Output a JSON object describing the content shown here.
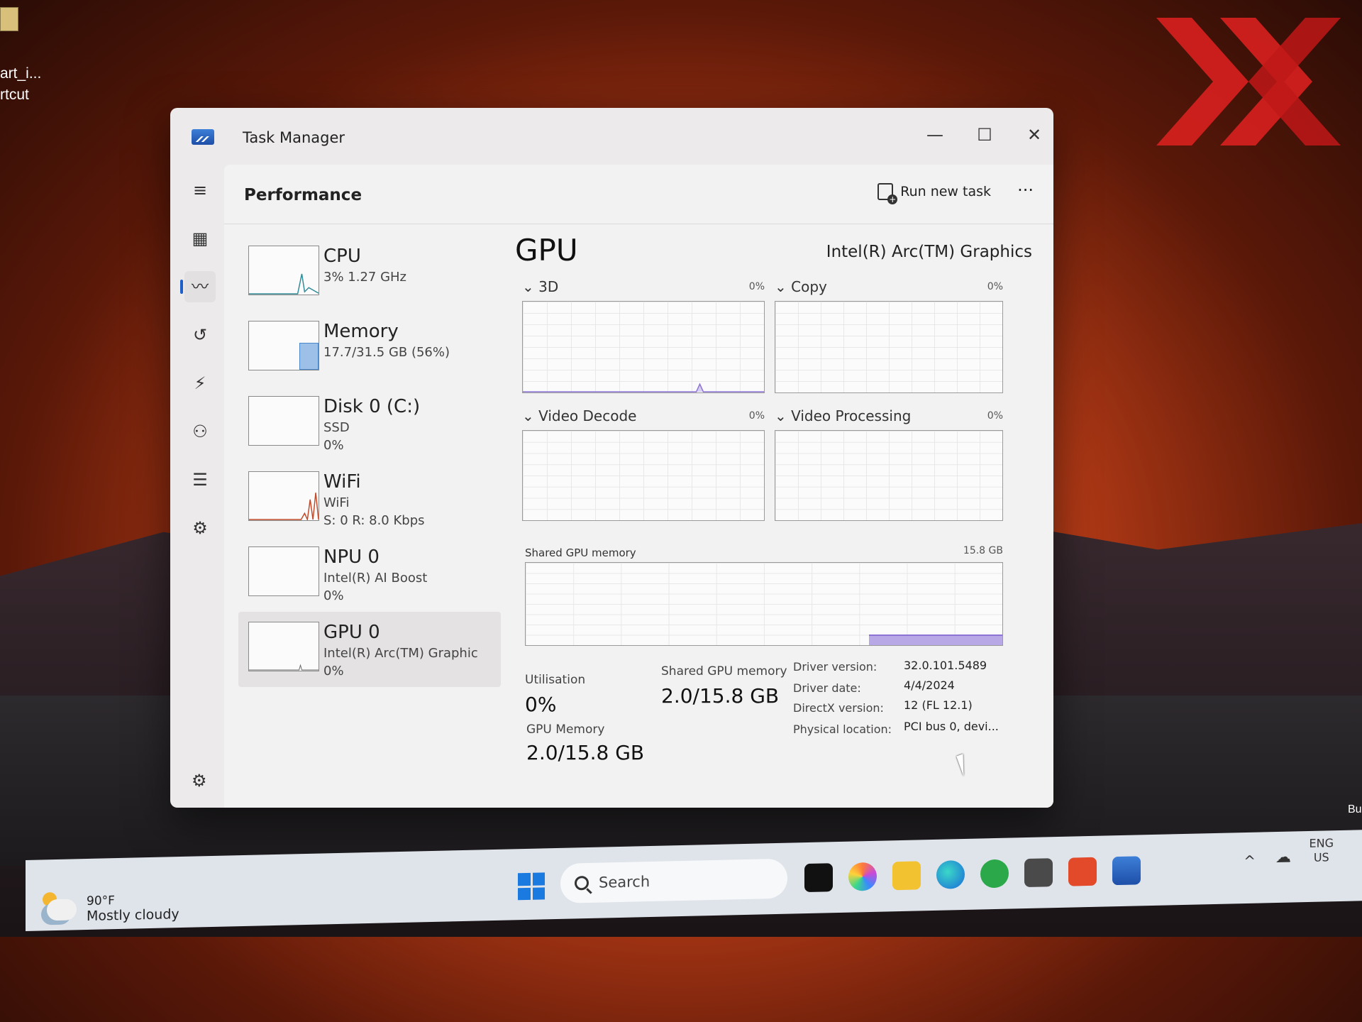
{
  "desktop": {
    "shortcut_label_1": "art_i...",
    "shortcut_label_2": "rtcut",
    "corner_text": "Bu"
  },
  "window": {
    "title": "Task Manager",
    "minimize": "—",
    "maximize": "☐",
    "close": "✕"
  },
  "nav": {
    "items": [
      {
        "icon": "hamburger-icon",
        "glyph": "≡"
      },
      {
        "icon": "processes-icon",
        "glyph": "▦"
      },
      {
        "icon": "performance-icon",
        "glyph": "〰"
      },
      {
        "icon": "app-history-icon",
        "glyph": "↺"
      },
      {
        "icon": "startup-apps-icon",
        "glyph": "⚡"
      },
      {
        "icon": "users-icon",
        "glyph": "⚇"
      },
      {
        "icon": "details-icon",
        "glyph": "☰"
      },
      {
        "icon": "services-icon",
        "glyph": "⚙"
      }
    ],
    "settings_glyph": "⚙"
  },
  "header": {
    "title": "Performance",
    "run_new_task": "Run new task",
    "more": "···"
  },
  "devices": [
    {
      "name": "CPU",
      "line1": "3%  1.27 GHz",
      "line2": ""
    },
    {
      "name": "Memory",
      "line1": "17.7/31.5 GB (56%)",
      "line2": ""
    },
    {
      "name": "Disk 0 (C:)",
      "line1": "SSD",
      "line2": "0%"
    },
    {
      "name": "WiFi",
      "line1": "WiFi",
      "line2": "S: 0  R: 8.0 Kbps"
    },
    {
      "name": "NPU 0",
      "line1": "Intel(R) AI Boost",
      "line2": "0%"
    },
    {
      "name": "GPU 0",
      "line1": "Intel(R) Arc(TM) Graphic",
      "line2": "0%"
    }
  ],
  "gpu": {
    "title": "GPU",
    "model": "Intel(R) Arc(TM) Graphics",
    "graphs": [
      {
        "label": "3D",
        "percent": "0%"
      },
      {
        "label": "Copy",
        "percent": "0%"
      },
      {
        "label": "Video Decode",
        "percent": "0%"
      },
      {
        "label": "Video Processing",
        "percent": "0%"
      }
    ],
    "chevron": "⌄",
    "shared_mem_label": "Shared GPU memory",
    "shared_mem_max": "15.8 GB",
    "shared_mem_fill": 0.127,
    "utilisation_label": "Utilisation",
    "utilisation_value": "0%",
    "shared_gpu_memory_label": "Shared GPU memory",
    "shared_gpu_memory_value": "2.0/15.8 GB",
    "gpu_memory_label": "GPU Memory",
    "gpu_memory_value": "2.0/15.8 GB",
    "details": [
      {
        "key": "Driver version:",
        "value": "32.0.101.5489"
      },
      {
        "key": "Driver date:",
        "value": "4/4/2024"
      },
      {
        "key": "DirectX version:",
        "value": "12 (FL 12.1)"
      },
      {
        "key": "Physical location:",
        "value": "PCI bus 0, devi..."
      }
    ]
  },
  "taskbar": {
    "temp": "90°F",
    "condition": "Mostly cloudy",
    "search_placeholder": "Search",
    "lang": "ENG",
    "region": "US",
    "chevron": "^",
    "accent": "#1a7ae0"
  }
}
